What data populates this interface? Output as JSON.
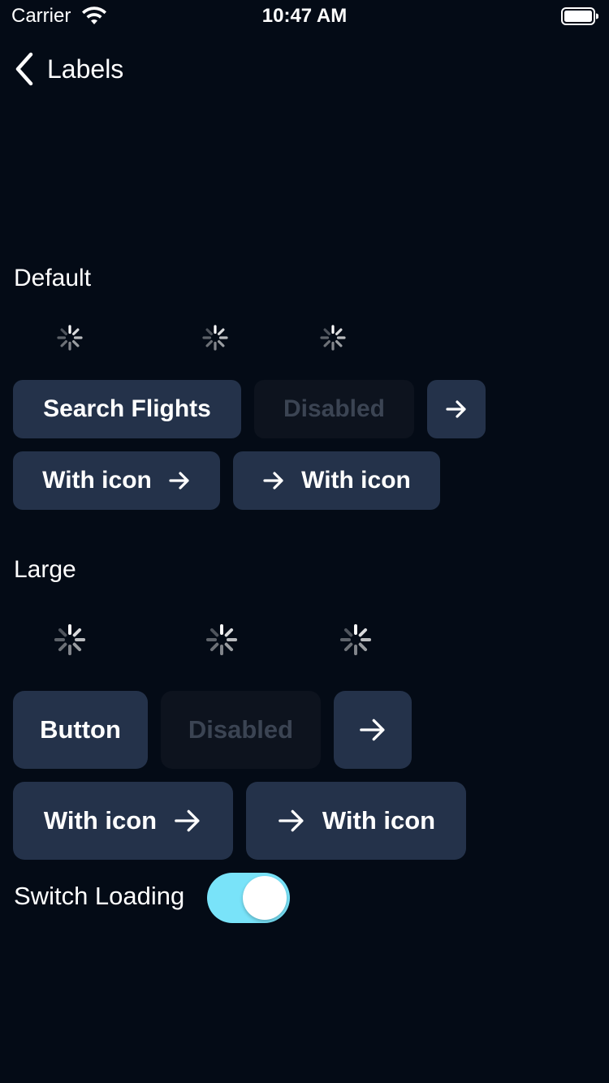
{
  "status_bar": {
    "carrier": "Carrier",
    "time": "10:47 AM",
    "wifi_icon": "wifi-icon",
    "battery_icon": "battery-icon"
  },
  "nav": {
    "back_icon": "chevron-left-icon",
    "title": "Labels"
  },
  "sections": {
    "default": {
      "title": "Default",
      "buttons": {
        "search": "Search Flights",
        "disabled": "Disabled",
        "arrow_only_icon": "arrow-right-icon",
        "icon_trailing": "With icon",
        "icon_leading": "With icon"
      }
    },
    "large": {
      "title": "Large",
      "buttons": {
        "button": "Button",
        "disabled": "Disabled",
        "arrow_only_icon": "arrow-right-icon",
        "icon_trailing": "With icon",
        "icon_leading": "With icon"
      }
    }
  },
  "switch": {
    "label": "Switch Loading",
    "on": true
  },
  "colors": {
    "background": "#040b16",
    "button": "#24324a",
    "button_disabled": "#0d131e",
    "disabled_text": "#3b4453",
    "switch_on": "#79e3f9"
  }
}
